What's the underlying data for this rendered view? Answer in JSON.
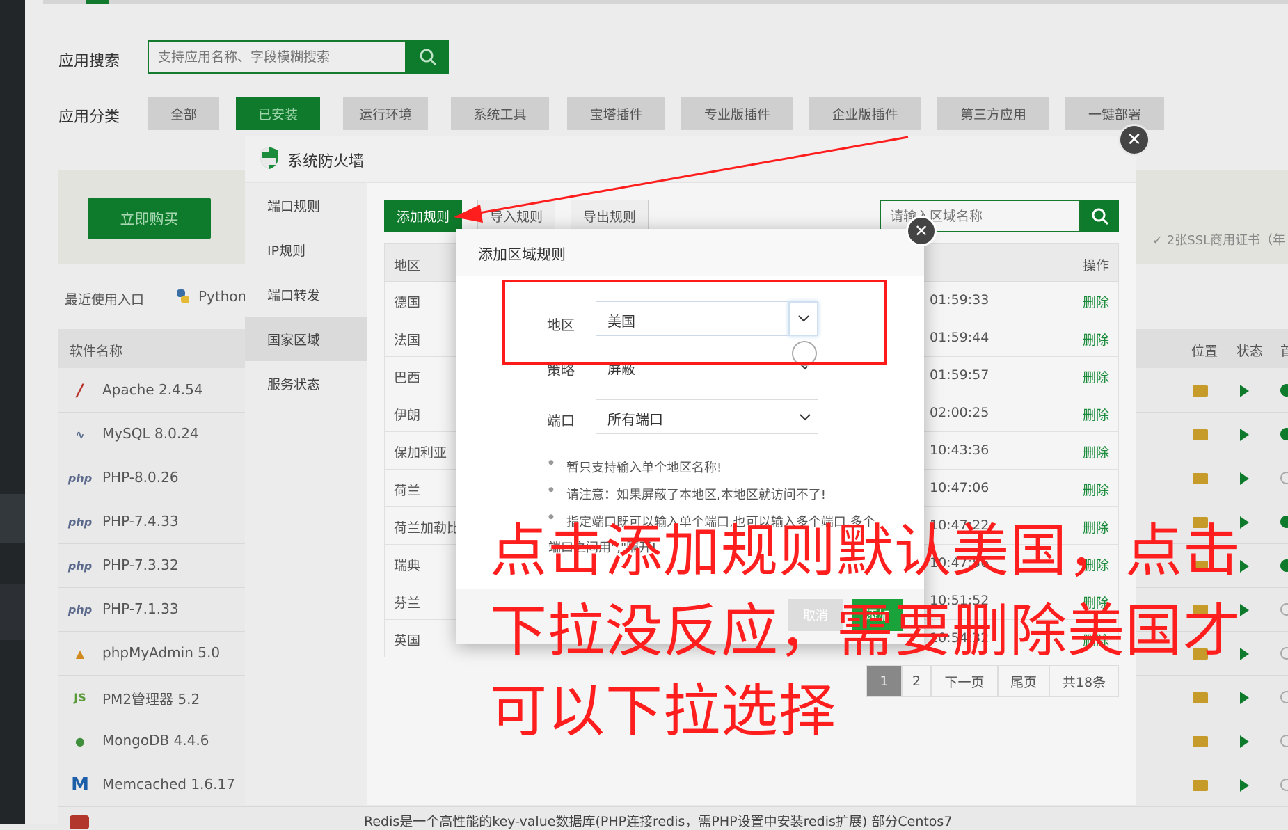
{
  "app": {
    "search_label": "应用搜索",
    "search_placeholder": "支持应用名称、字段模糊搜索",
    "category_label": "应用分类",
    "categories": [
      "全部",
      "已安装",
      "运行环境",
      "系统工具",
      "宝塔插件",
      "专业版插件",
      "企业版插件",
      "第三方应用",
      "一键部署"
    ],
    "active_category": "已安装",
    "buy_button": "立即购买",
    "ssl_note": "✓ 2张SSL商用证书（年",
    "recent_label": "最近使用入口",
    "recent_items": [
      "Python"
    ],
    "table_headers": {
      "name": "软件名称",
      "location": "位置",
      "status": "状态",
      "home": "首"
    },
    "software": [
      {
        "name": "Apache 2.4.54",
        "icon": "feather-icon",
        "running": true
      },
      {
        "name": "MySQL 8.0.24",
        "icon": "dolphin-icon",
        "running": true
      },
      {
        "name": "PHP-8.0.26",
        "icon": "php-icon",
        "running": false
      },
      {
        "name": "PHP-7.4.33",
        "icon": "php-icon",
        "running": true
      },
      {
        "name": "PHP-7.3.32",
        "icon": "php-icon",
        "running": true
      },
      {
        "name": "PHP-7.1.33",
        "icon": "php-icon",
        "running": false
      },
      {
        "name": "phpMyAdmin 5.0",
        "icon": "sailboat-icon",
        "running": false
      },
      {
        "name": "PM2管理器 5.2",
        "icon": "nodejs-icon",
        "running": false
      },
      {
        "name": "MongoDB 4.4.6",
        "icon": "leaf-icon",
        "running": false
      },
      {
        "name": "Memcached 1.6.17",
        "icon": "m-icon",
        "running": false
      }
    ],
    "bottom_desc": "Redis是一个高性能的key-value数据库(PHP连接redis，需PHP设置中安装redis扩展) 部分Centos7"
  },
  "firewall": {
    "title": "系统防火墙",
    "nav": [
      "端口规则",
      "IP规则",
      "端口转发",
      "国家区域",
      "服务状态"
    ],
    "active_nav": "国家区域",
    "buttons": {
      "add": "添加规则",
      "import": "导入规则",
      "export": "导出规则"
    },
    "search_placeholder": "请输入区域名称",
    "columns": {
      "region": "地区",
      "action": "操作"
    },
    "rows": [
      {
        "region": "德国",
        "time": "01:59:33",
        "action": "删除"
      },
      {
        "region": "法国",
        "time": "01:59:44",
        "action": "删除"
      },
      {
        "region": "巴西",
        "time": "01:59:57",
        "action": "删除"
      },
      {
        "region": "伊朗",
        "time": "02:00:25",
        "action": "删除"
      },
      {
        "region": "保加利亚",
        "time": "10:43:36",
        "action": "删除"
      },
      {
        "region": "荷兰",
        "time": "10:47:06",
        "action": "删除"
      },
      {
        "region": "荷兰加勒比",
        "time": "10:47:22",
        "action": "删除"
      },
      {
        "region": "瑞典",
        "time": "10:47:56",
        "action": "删除"
      },
      {
        "region": "芬兰",
        "time": "10:51:52",
        "action": "删除"
      },
      {
        "region": "英国",
        "time": "10:54:32",
        "action": "删除"
      }
    ],
    "pagination": {
      "pages": [
        "1",
        "2"
      ],
      "current": "1",
      "next": "下一页",
      "last": "尾页",
      "total": "共18条"
    }
  },
  "dialog": {
    "title": "添加区域规则",
    "region_label": "地区",
    "region_value": "美国",
    "strategy_label": "策略",
    "strategy_value": "屏蔽",
    "port_label": "端口",
    "port_value": "所有端口",
    "notes": [
      "暂只支持输入单个地区名称!",
      "请注意：如果屏蔽了本地区,本地区就访问不了!",
      "指定端口既可以输入单个端口,也可以输入多个端口,多个",
      "端口之间用\",\"隔开!"
    ],
    "cancel": "取消",
    "confirm": "添加"
  },
  "annotation": {
    "lines": [
      "点击添加规则默认美国，点击",
      "下拉没反应，需要删除美国才",
      "可以下拉选择"
    ],
    "color": "#ff1e1e"
  },
  "colors": {
    "brand_green": "#0e7a2b",
    "delete_green": "#1a8b3a",
    "annotation_red": "#ff1e1e"
  }
}
